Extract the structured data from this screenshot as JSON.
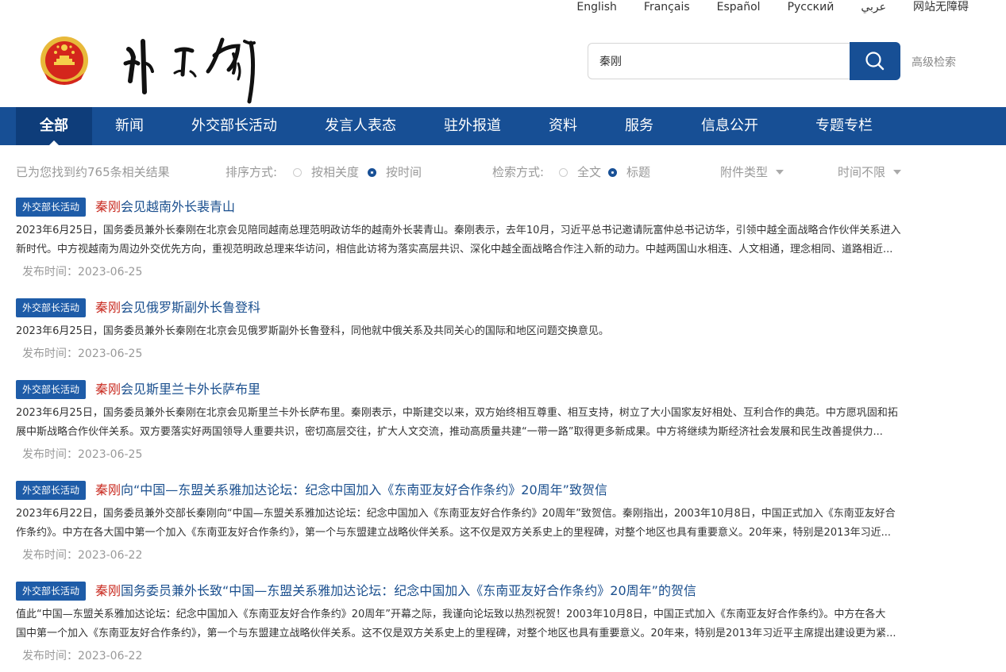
{
  "languages": [
    "English",
    "Français",
    "Español",
    "Русский",
    "عربي",
    "网站无障碍"
  ],
  "header": {
    "logo_alt": "外交部"
  },
  "search": {
    "value": "秦刚",
    "advanced_label": "高级检索"
  },
  "nav": {
    "items": [
      "全部",
      "新闻",
      "外交部长活动",
      "发言人表态",
      "驻外报道",
      "资料",
      "服务",
      "信息公开",
      "专题专栏"
    ],
    "active_index": 0
  },
  "filters": {
    "result_count": "已为您找到约765条相关结果",
    "sort_label": "排序方式:",
    "sort_options": [
      "按相关度",
      "按时间"
    ],
    "sort_selected": "按时间",
    "search_mode_label": "检索方式:",
    "search_mode_options": [
      "全文",
      "标题"
    ],
    "search_mode_selected": "标题",
    "attachment_type": "附件类型",
    "time_range": "时间不限"
  },
  "results": [
    {
      "tag": "外交部长活动",
      "title_highlight": "秦刚",
      "title_rest": "会见越南外长裴青山",
      "summary_lines": [
        "2023年6月25日，国务委员兼外长秦刚在北京会见陪同越南总理范明政访华的越南外长裴青山。秦刚表示，去年10月，习近平总书记邀请阮富仲总书记访华，引领中越全面战略合作伙伴关系进入",
        "新时代。中方视越南为周边外交优先方向，重视范明政总理来华访问，相信此访将为落实高层共识、深化中越全面战略合作注入新的动力。中越两国山水相连、人文相通，理念相同、道路相近..."
      ],
      "date": "发布时间：2023-06-25"
    },
    {
      "tag": "外交部长活动",
      "title_highlight": "秦刚",
      "title_rest": "会见俄罗斯副外长鲁登科",
      "summary_lines": [
        "2023年6月25日，国务委员兼外长秦刚在北京会见俄罗斯副外长鲁登科，同他就中俄关系及共同关心的国际和地区问题交换意见。"
      ],
      "date": "发布时间：2023-06-25"
    },
    {
      "tag": "外交部长活动",
      "title_highlight": "秦刚",
      "title_rest": "会见斯里兰卡外长萨布里",
      "summary_lines": [
        "2023年6月25日，国务委员兼外长秦刚在北京会见斯里兰卡外长萨布里。秦刚表示，中斯建交以来，双方始终相互尊重、相互支持，树立了大小国家友好相处、互利合作的典范。中方愿巩固和拓",
        "展中斯战略合作伙伴关系。双方要落实好两国领导人重要共识，密切高层交往，扩大人文交流，推动高质量共建“一带一路”取得更多新成果。中方将继续为斯经济社会发展和民生改善提供力..."
      ],
      "date": "发布时间：2023-06-25"
    },
    {
      "tag": "外交部长活动",
      "title_highlight": "秦刚",
      "title_rest": "向“中国—东盟关系雅加达论坛：纪念中国加入《东南亚友好合作条约》20周年”致贺信",
      "summary_lines": [
        "2023年6月22日，国务委员兼外交部长秦刚向“中国—东盟关系雅加达论坛：纪念中国加入《东南亚友好合作条约》20周年”致贺信。秦刚指出，2003年10月8日，中国正式加入《东南亚友好合",
        "作条约》。中方在各大国中第一个加入《东南亚友好合作条约》，第一个与东盟建立战略伙伴关系。这不仅是双方关系史上的里程碑，对整个地区也具有重要意义。20年来，特别是2013年习近..."
      ],
      "date": "发布时间：2023-06-22"
    },
    {
      "tag": "外交部长活动",
      "title_highlight": "秦刚",
      "title_rest": "国务委员兼外长致“中国—东盟关系雅加达论坛：纪念中国加入《东南亚友好合作条约》20周年”的贺信",
      "summary_lines": [
        "值此“中国—东盟关系雅加达论坛：纪念中国加入《东南亚友好合作条约》20周年”开幕之际，我谨向论坛致以热烈祝贺！2003年10月8日，中国正式加入《东南亚友好合作条约》。中方在各大",
        "国中第一个加入《东南亚友好合作条约》，第一个与东盟建立战略伙伴关系。这不仅是双方关系史上的里程碑，对整个地区也具有重要意义。20年来，特别是2013年习近平主席提出建设更为紧..."
      ],
      "date": "发布时间：2023-06-22"
    }
  ]
}
